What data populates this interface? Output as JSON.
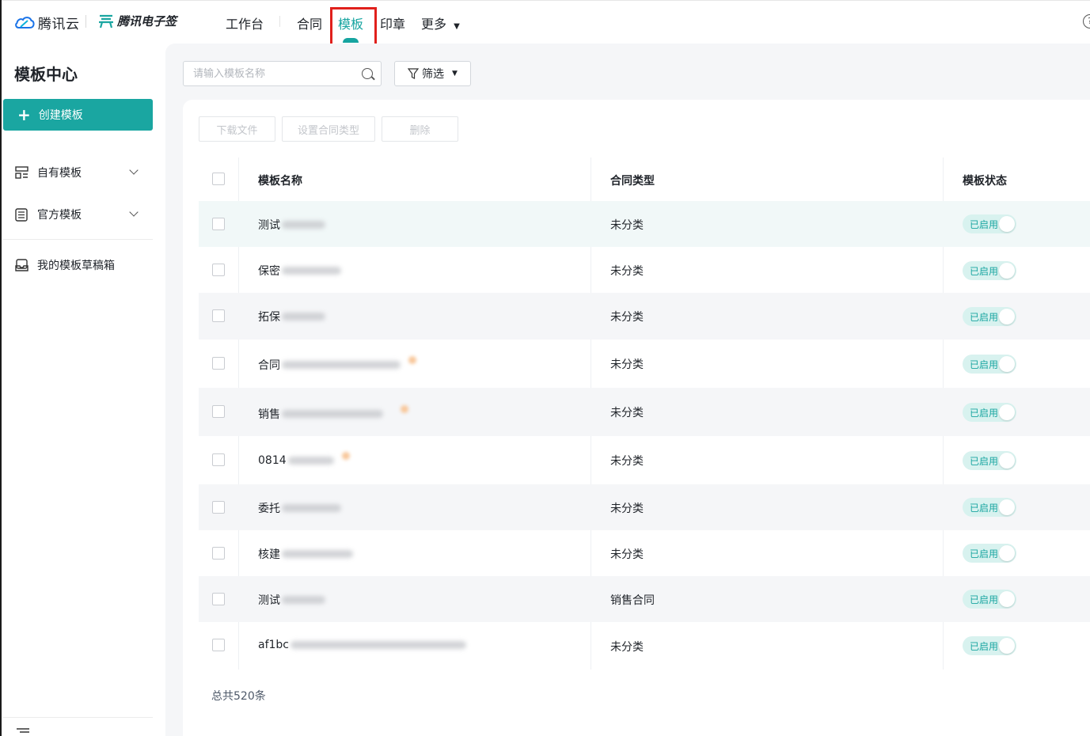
{
  "brand": {
    "cloud_name": "腾讯云",
    "product_name": "腾讯电子签"
  },
  "nav": {
    "items": [
      {
        "label": "工作台"
      },
      {
        "label": "合同"
      },
      {
        "label": "模板"
      },
      {
        "label": "印章"
      },
      {
        "label": "更多"
      }
    ],
    "active": "模板"
  },
  "sidebar": {
    "title": "模板中心",
    "create_label": "创建模板",
    "items": [
      {
        "label": "自有模板"
      },
      {
        "label": "官方模板"
      },
      {
        "label": "我的模板草稿箱"
      }
    ]
  },
  "toolbar": {
    "search_placeholder": "请输入模板名称",
    "filter_label": "筛选",
    "actions": [
      "下载文件",
      "设置合同类型",
      "删除"
    ]
  },
  "table": {
    "headers": [
      "模板名称",
      "合同类型",
      "模板状态"
    ],
    "rows": [
      {
        "name": "测试",
        "type": "未分类",
        "status": "已启用"
      },
      {
        "name": "保密",
        "type": "未分类",
        "status": "已启用"
      },
      {
        "name": "拓保",
        "type": "未分类",
        "status": "已启用"
      },
      {
        "name": "合同",
        "type": "未分类",
        "status": "已启用"
      },
      {
        "name": "销售",
        "type": "未分类",
        "status": "已启用"
      },
      {
        "name": "0814",
        "type": "未分类",
        "status": "已启用"
      },
      {
        "name": "委托",
        "type": "未分类",
        "status": "已启用"
      },
      {
        "name": "核建",
        "type": "未分类",
        "status": "已启用"
      },
      {
        "name": "测试",
        "type": "销售合同",
        "status": "已启用"
      },
      {
        "name": "af1bc",
        "type": "未分类",
        "status": "已启用"
      }
    ]
  },
  "footer": {
    "total": "总共520条"
  },
  "colors": {
    "accent": "#1aa6a1",
    "highlight": "#e0201c"
  }
}
